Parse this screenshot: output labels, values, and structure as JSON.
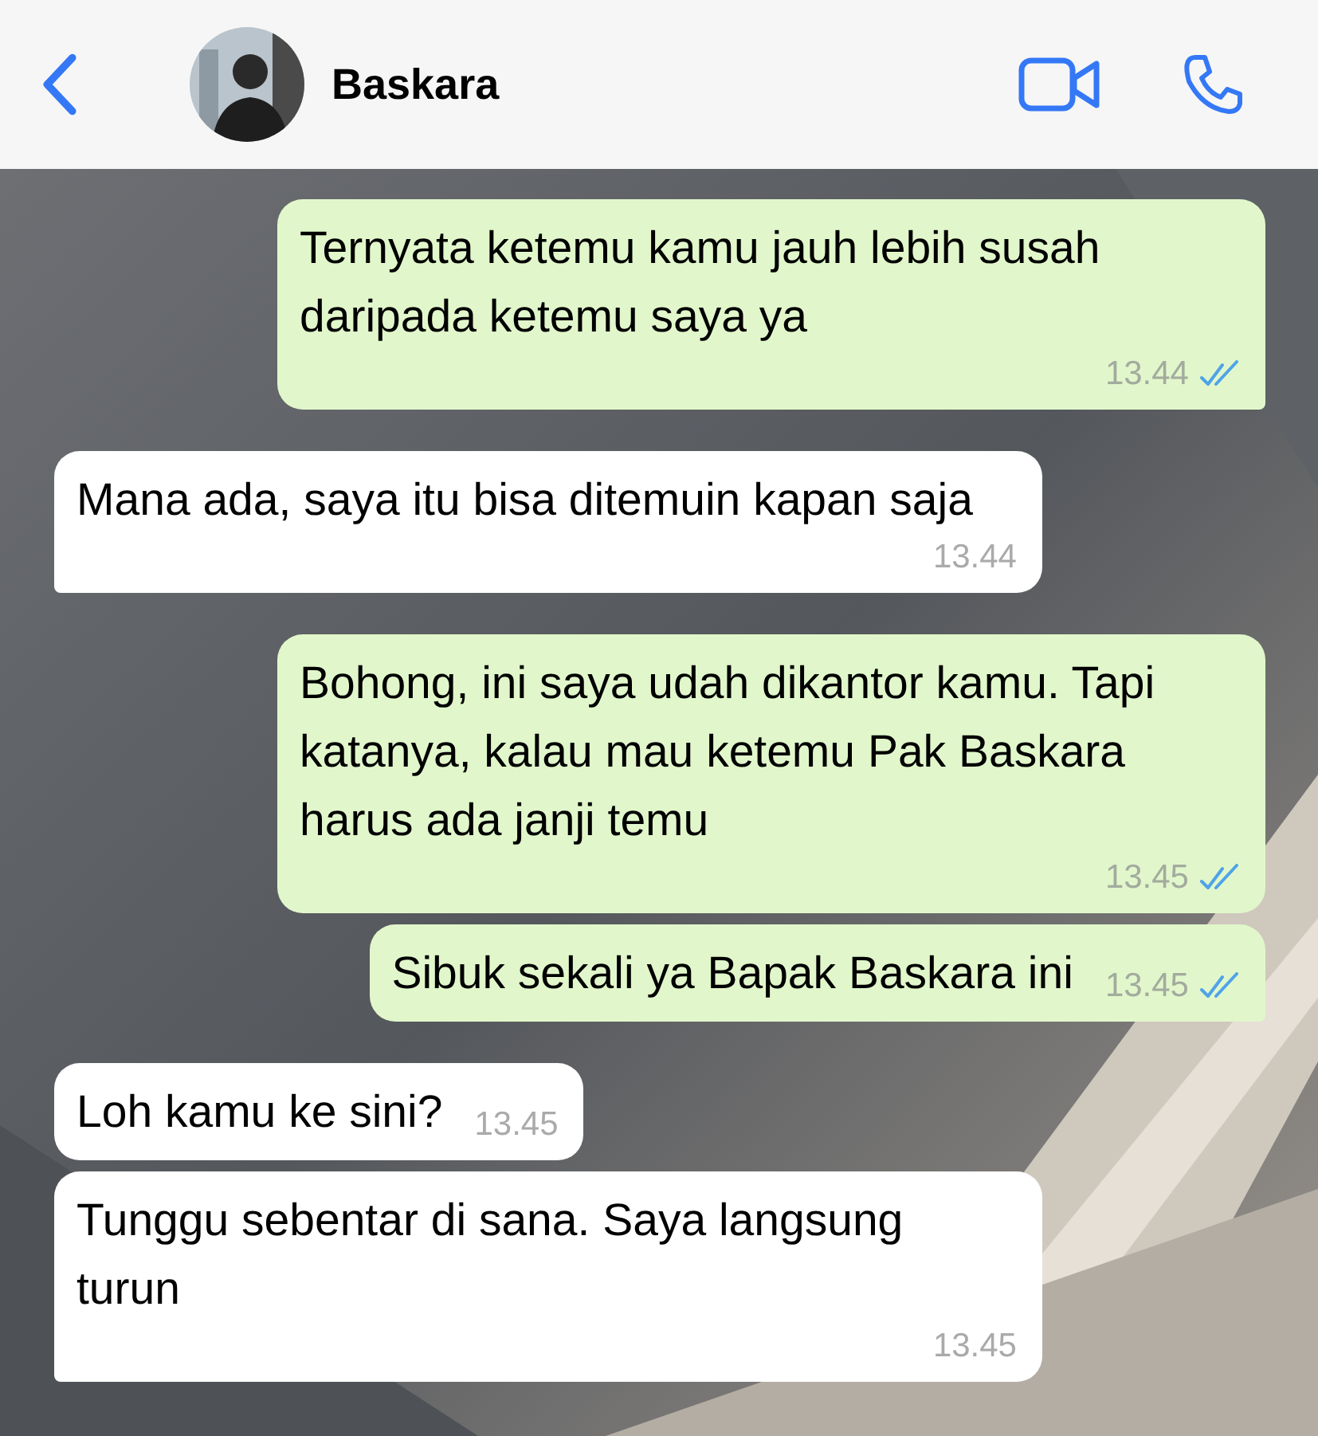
{
  "header": {
    "contact_name": "Baskara"
  },
  "messages": [
    {
      "kind": "out",
      "text": "Ternyata ketemu kamu jauh lebih susah daripada ketemu saya ya",
      "time": "13.44",
      "read": true,
      "tail": true
    },
    {
      "kind": "in",
      "text": "Mana ada, saya itu bisa ditemuin kapan saja",
      "time": "13.44",
      "tail": true
    },
    {
      "kind": "out",
      "text": "Bohong, ini saya udah dikantor kamu. Tapi katanya, kalau mau ketemu Pak Baskara harus ada janji temu",
      "time": "13.45",
      "read": true,
      "tail": false
    },
    {
      "kind": "out",
      "text": "Sibuk sekali ya Bapak Baskara ini",
      "time": "13.45",
      "read": true,
      "tail": true
    },
    {
      "kind": "in",
      "text": "Loh kamu ke sini?",
      "time": "13.45",
      "tail": false
    },
    {
      "kind": "in",
      "text": "Tunggu sebentar di sana. Saya langsung turun",
      "time": "13.45",
      "tail": true
    }
  ]
}
